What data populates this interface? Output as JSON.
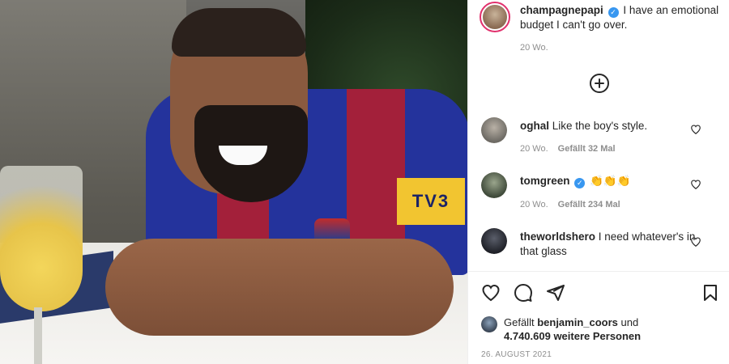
{
  "post": {
    "username": "champagnepapi",
    "caption": "I have an emotional budget I can't go over.",
    "time_ago": "20 Wo.",
    "badge_text": "TV3"
  },
  "comments": [
    {
      "username": "oghal",
      "text": "Like the boy's style.",
      "time_ago": "20 Wo.",
      "likes": "Gefällt 32 Mal",
      "verified": false
    },
    {
      "username": "tomgreen",
      "text": "👏👏👏",
      "time_ago": "20 Wo.",
      "likes": "Gefällt 234 Mal",
      "verified": true
    },
    {
      "username": "theworldshero",
      "text": "I need whatever's in that glass",
      "verified": false
    }
  ],
  "likes_summary": {
    "prefix": "Gefällt",
    "first_liker": "benjamin_coors",
    "connector": "und",
    "others": "4.740.609 weitere Personen"
  },
  "date": "26. AUGUST 2021",
  "icons": {
    "load_more": "plus-circle-icon",
    "like": "heart-icon",
    "comment": "comment-icon",
    "share": "send-icon",
    "save": "bookmark-icon",
    "verified": "verified-badge-icon"
  },
  "colors": {
    "verified": "#3897f0",
    "story_ring": "#e1306c",
    "muted_text": "#8e8e8e",
    "text": "#262626"
  }
}
